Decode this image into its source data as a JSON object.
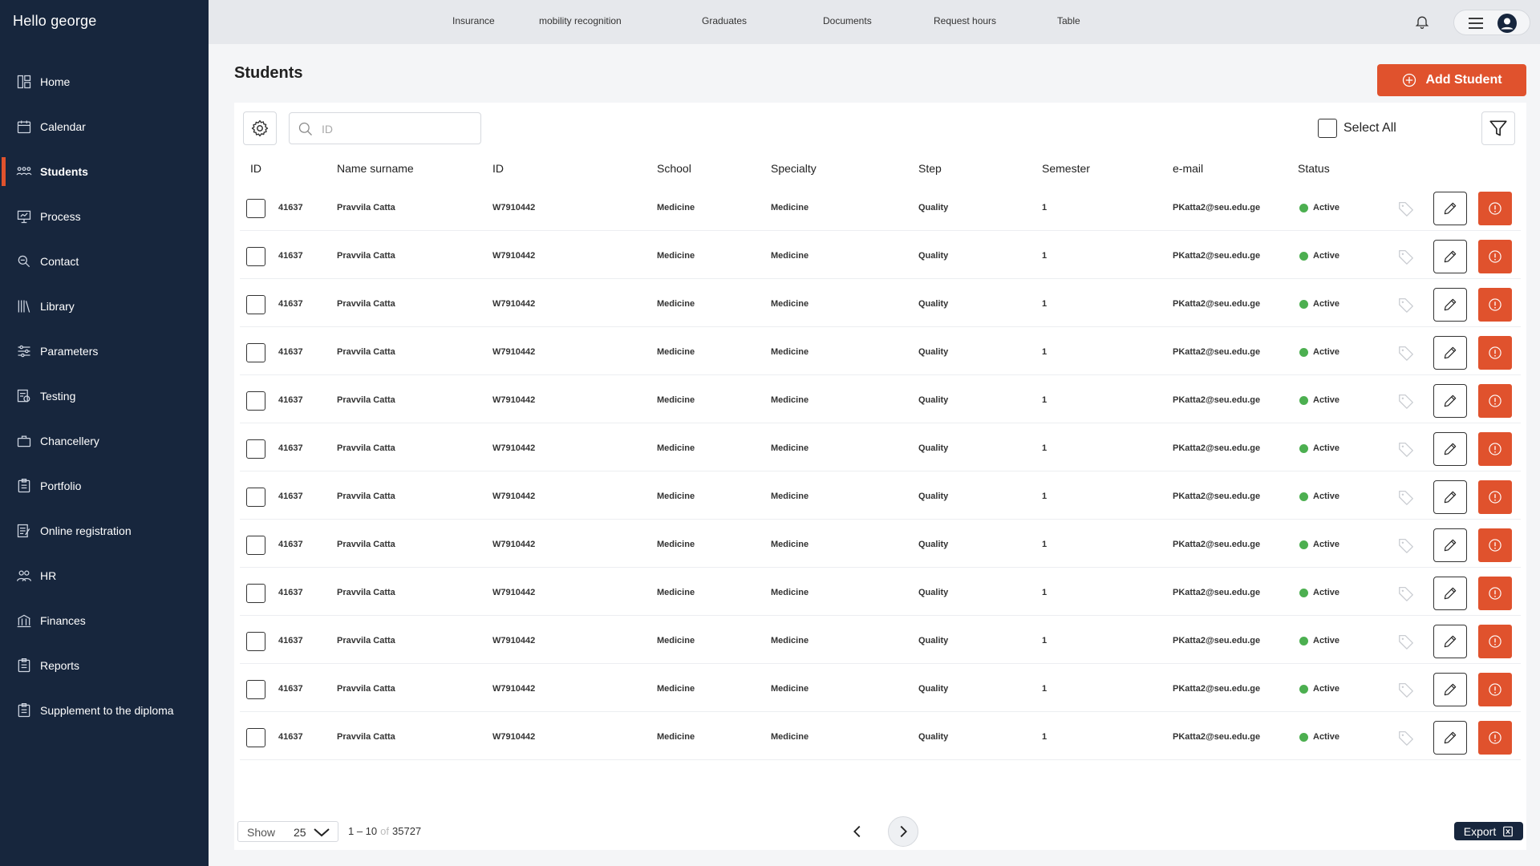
{
  "sidebar": {
    "greeting": "Hello george",
    "items": [
      {
        "label": "Home",
        "icon": "home-icon"
      },
      {
        "label": "Calendar",
        "icon": "calendar-icon"
      },
      {
        "label": "Students",
        "icon": "students-icon",
        "active": true
      },
      {
        "label": "Process",
        "icon": "process-icon"
      },
      {
        "label": "Contact",
        "icon": "contact-icon"
      },
      {
        "label": "Library",
        "icon": "library-icon"
      },
      {
        "label": "Parameters",
        "icon": "parameters-icon"
      },
      {
        "label": "Testing",
        "icon": "testing-icon"
      },
      {
        "label": "Chancellery",
        "icon": "chancellery-icon"
      },
      {
        "label": "Portfolio",
        "icon": "portfolio-icon"
      },
      {
        "label": "Online registration",
        "icon": "online-registration-icon"
      },
      {
        "label": "HR",
        "icon": "hr-icon"
      },
      {
        "label": "Finances",
        "icon": "finances-icon"
      },
      {
        "label": "Reports",
        "icon": "reports-icon"
      },
      {
        "label": "Supplement to the diploma",
        "icon": "diploma-supplement-icon"
      }
    ]
  },
  "topnav": {
    "links": [
      "Insurance",
      "mobility recognition",
      "Graduates",
      "Documents",
      "Request hours",
      "Table"
    ]
  },
  "main": {
    "title": "Students",
    "add_button": "Add Student",
    "search_placeholder": "ID",
    "select_all": "Select All",
    "columns": [
      "ID",
      "Name surname",
      "ID",
      "School",
      "Specialty",
      "Step",
      "Semester",
      "e-mail",
      "Status"
    ],
    "rows": [
      {
        "id": "41637",
        "name": "Pravvila Catta",
        "code": "W7910442",
        "school": "Medicine",
        "specialty": "Medicine",
        "step": "Quality",
        "semester": "1",
        "email": "PKatta2@seu.edu.ge",
        "status": "Active"
      },
      {
        "id": "41637",
        "name": "Pravvila Catta",
        "code": "W7910442",
        "school": "Medicine",
        "specialty": "Medicine",
        "step": "Quality",
        "semester": "1",
        "email": "PKatta2@seu.edu.ge",
        "status": "Active"
      },
      {
        "id": "41637",
        "name": "Pravvila Catta",
        "code": "W7910442",
        "school": "Medicine",
        "specialty": "Medicine",
        "step": "Quality",
        "semester": "1",
        "email": "PKatta2@seu.edu.ge",
        "status": "Active"
      },
      {
        "id": "41637",
        "name": "Pravvila Catta",
        "code": "W7910442",
        "school": "Medicine",
        "specialty": "Medicine",
        "step": "Quality",
        "semester": "1",
        "email": "PKatta2@seu.edu.ge",
        "status": "Active"
      },
      {
        "id": "41637",
        "name": "Pravvila Catta",
        "code": "W7910442",
        "school": "Medicine",
        "specialty": "Medicine",
        "step": "Quality",
        "semester": "1",
        "email": "PKatta2@seu.edu.ge",
        "status": "Active"
      },
      {
        "id": "41637",
        "name": "Pravvila Catta",
        "code": "W7910442",
        "school": "Medicine",
        "specialty": "Medicine",
        "step": "Quality",
        "semester": "1",
        "email": "PKatta2@seu.edu.ge",
        "status": "Active"
      },
      {
        "id": "41637",
        "name": "Pravvila Catta",
        "code": "W7910442",
        "school": "Medicine",
        "specialty": "Medicine",
        "step": "Quality",
        "semester": "1",
        "email": "PKatta2@seu.edu.ge",
        "status": "Active"
      },
      {
        "id": "41637",
        "name": "Pravvila Catta",
        "code": "W7910442",
        "school": "Medicine",
        "specialty": "Medicine",
        "step": "Quality",
        "semester": "1",
        "email": "PKatta2@seu.edu.ge",
        "status": "Active"
      },
      {
        "id": "41637",
        "name": "Pravvila Catta",
        "code": "W7910442",
        "school": "Medicine",
        "specialty": "Medicine",
        "step": "Quality",
        "semester": "1",
        "email": "PKatta2@seu.edu.ge",
        "status": "Active"
      },
      {
        "id": "41637",
        "name": "Pravvila Catta",
        "code": "W7910442",
        "school": "Medicine",
        "specialty": "Medicine",
        "step": "Quality",
        "semester": "1",
        "email": "PKatta2@seu.edu.ge",
        "status": "Active"
      },
      {
        "id": "41637",
        "name": "Pravvila Catta",
        "code": "W7910442",
        "school": "Medicine",
        "specialty": "Medicine",
        "step": "Quality",
        "semester": "1",
        "email": "PKatta2@seu.edu.ge",
        "status": "Active"
      },
      {
        "id": "41637",
        "name": "Pravvila Catta",
        "code": "W7910442",
        "school": "Medicine",
        "specialty": "Medicine",
        "step": "Quality",
        "semester": "1",
        "email": "PKatta2@seu.edu.ge",
        "status": "Active"
      }
    ]
  },
  "footer": {
    "show_label": "Show",
    "page_size": "25",
    "range": "1 – 10",
    "of": "of",
    "total": "35727",
    "export": "Export"
  },
  "colors": {
    "sidebar_bg": "#17263d",
    "accent": "#e0522d",
    "active_status": "#4caf50"
  }
}
